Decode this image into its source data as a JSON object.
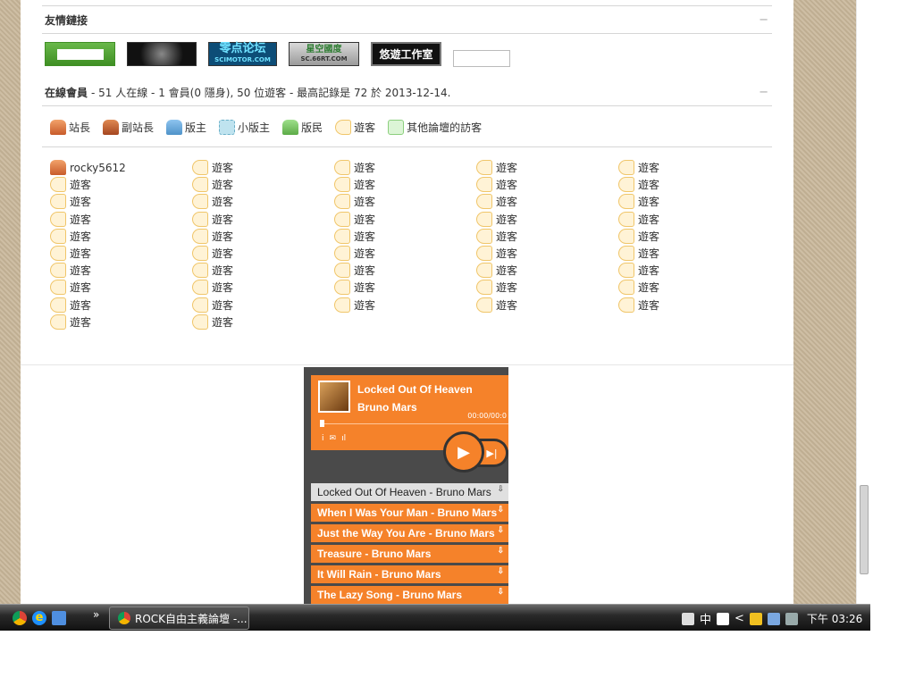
{
  "friend_links": {
    "title": "友情鏈接",
    "collapse": "−",
    "logos": [
      {
        "name": "",
        "sub": ""
      },
      {
        "name": "",
        "sub": ""
      },
      {
        "name": "零点论坛",
        "sub": "SCIMOTOR.COM"
      },
      {
        "name": "星空國度",
        "sub": "SC.66RT.COM"
      },
      {
        "name": "悠遊工作室",
        "sub": ""
      }
    ]
  },
  "online": {
    "title": "在線會員",
    "summary": "- 51 人在線 - 1 會員(0 隱身), 50 位遊客 - 最高記錄是 72 於 2013-12-14.",
    "collapse": "−",
    "legend": [
      {
        "icon": "admin-icon",
        "label": "站長"
      },
      {
        "icon": "vice-admin-icon",
        "label": "副站長"
      },
      {
        "icon": "moderator-icon",
        "label": "版主"
      },
      {
        "icon": "sub-moderator-icon",
        "label": "小版主"
      },
      {
        "icon": "member-icon",
        "label": "版民"
      },
      {
        "icon": "guest-icon",
        "label": "遊客"
      },
      {
        "icon": "other-visitor-icon",
        "label": "其他論壇的訪客"
      }
    ],
    "users": [
      {
        "name": "rocky5612",
        "type": "admin"
      },
      {
        "name": "遊客",
        "type": "guest"
      },
      {
        "name": "遊客",
        "type": "guest"
      },
      {
        "name": "遊客",
        "type": "guest"
      },
      {
        "name": "遊客",
        "type": "guest"
      },
      {
        "name": "遊客",
        "type": "guest"
      },
      {
        "name": "遊客",
        "type": "guest"
      },
      {
        "name": "遊客",
        "type": "guest"
      },
      {
        "name": "遊客",
        "type": "guest"
      },
      {
        "name": "遊客",
        "type": "guest"
      },
      {
        "name": "遊客",
        "type": "guest"
      },
      {
        "name": "遊客",
        "type": "guest"
      },
      {
        "name": "遊客",
        "type": "guest"
      },
      {
        "name": "遊客",
        "type": "guest"
      },
      {
        "name": "遊客",
        "type": "guest"
      },
      {
        "name": "遊客",
        "type": "guest"
      },
      {
        "name": "遊客",
        "type": "guest"
      },
      {
        "name": "遊客",
        "type": "guest"
      },
      {
        "name": "遊客",
        "type": "guest"
      },
      {
        "name": "遊客",
        "type": "guest"
      },
      {
        "name": "遊客",
        "type": "guest"
      },
      {
        "name": "遊客",
        "type": "guest"
      },
      {
        "name": "遊客",
        "type": "guest"
      },
      {
        "name": "遊客",
        "type": "guest"
      },
      {
        "name": "遊客",
        "type": "guest"
      },
      {
        "name": "遊客",
        "type": "guest"
      },
      {
        "name": "遊客",
        "type": "guest"
      },
      {
        "name": "遊客",
        "type": "guest"
      },
      {
        "name": "遊客",
        "type": "guest"
      },
      {
        "name": "遊客",
        "type": "guest"
      },
      {
        "name": "遊客",
        "type": "guest"
      },
      {
        "name": "遊客",
        "type": "guest"
      },
      {
        "name": "遊客",
        "type": "guest"
      },
      {
        "name": "遊客",
        "type": "guest"
      },
      {
        "name": "遊客",
        "type": "guest"
      },
      {
        "name": "遊客",
        "type": "guest"
      },
      {
        "name": "遊客",
        "type": "guest"
      },
      {
        "name": "遊客",
        "type": "guest"
      },
      {
        "name": "遊客",
        "type": "guest"
      },
      {
        "name": "遊客",
        "type": "guest"
      },
      {
        "name": "遊客",
        "type": "guest"
      },
      {
        "name": "遊客",
        "type": "guest"
      },
      {
        "name": "遊客",
        "type": "guest"
      },
      {
        "name": "遊客",
        "type": "guest"
      },
      {
        "name": "遊客",
        "type": "guest"
      },
      {
        "name": "遊客",
        "type": "guest"
      },
      {
        "name": "遊客",
        "type": "guest"
      }
    ]
  },
  "player": {
    "track_title": "Locked Out Of Heaven",
    "track_artist": "Bruno Mars",
    "time": "00:00/00:0",
    "progress": 0,
    "info_icons": [
      "i",
      "✉",
      "ıl"
    ],
    "play_symbol": "▶",
    "next_symbol": "▶|",
    "download_symbol": "⇩",
    "playlist": [
      {
        "label": "Locked Out Of Heaven - Bruno Mars",
        "active": true
      },
      {
        "label": "When I Was Your Man - Bruno Mars",
        "active": false
      },
      {
        "label": "Just the Way You Are - Bruno Mars",
        "active": false
      },
      {
        "label": "Treasure - Bruno Mars",
        "active": false
      },
      {
        "label": "It Will Rain - Bruno Mars",
        "active": false
      },
      {
        "label": "The Lazy Song - Bruno Mars",
        "active": false
      }
    ]
  },
  "taskbar": {
    "overflow": "»",
    "task_label": "ROCK自由主義論壇 -...",
    "tray_ime": "中",
    "tray_arrow": "<",
    "clock": "下午 03:26"
  },
  "colors": {
    "accent_orange": "#f5822a",
    "player_bg": "#4a4a4a",
    "page_border": "#c9b79a"
  }
}
